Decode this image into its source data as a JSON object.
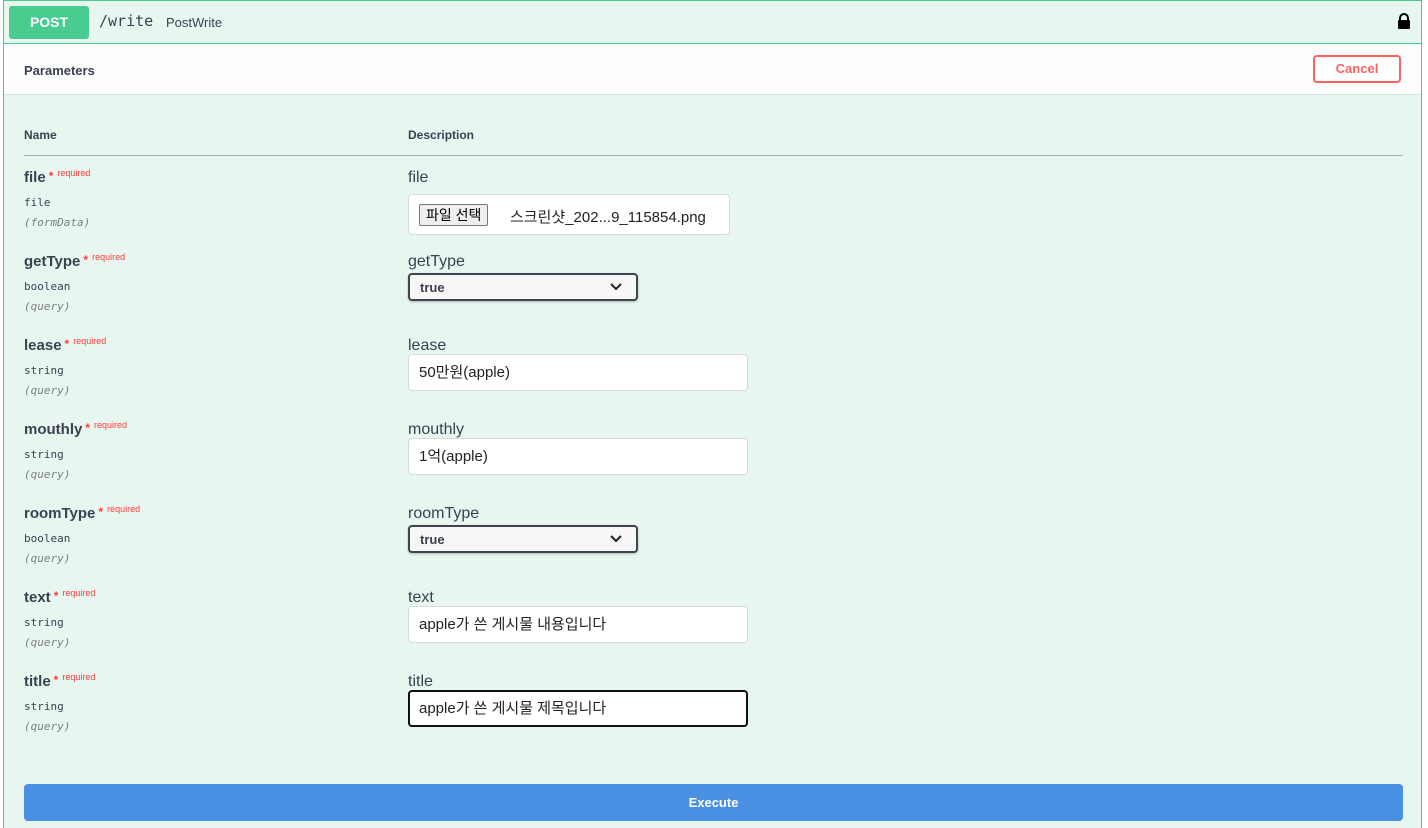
{
  "operation": {
    "method": "POST",
    "path": "/write",
    "summary": "PostWrite"
  },
  "section": {
    "title": "Parameters",
    "cancel_label": "Cancel"
  },
  "columns": {
    "name": "Name",
    "description": "Description"
  },
  "required_label": "required",
  "required_star": "*",
  "params": [
    {
      "name": "file",
      "type": "file",
      "in": "(formData)",
      "label": "file",
      "control": "file",
      "button_label": "파일 선택",
      "value": "스크린샷_202...9_115854.png"
    },
    {
      "name": "getType",
      "type": "boolean",
      "in": "(query)",
      "label": "getType",
      "control": "select",
      "value": "true"
    },
    {
      "name": "lease",
      "type": "string",
      "in": "(query)",
      "label": "lease",
      "control": "text",
      "value": "50만원(apple)"
    },
    {
      "name": "mouthly",
      "type": "string",
      "in": "(query)",
      "label": "mouthly",
      "control": "text",
      "value": "1억(apple)"
    },
    {
      "name": "roomType",
      "type": "boolean",
      "in": "(query)",
      "label": "roomType",
      "control": "select",
      "value": "true"
    },
    {
      "name": "text",
      "type": "string",
      "in": "(query)",
      "label": "text",
      "control": "text",
      "value": "apple가 쓴 게시물 내용입니다"
    },
    {
      "name": "title",
      "type": "string",
      "in": "(query)",
      "label": "title",
      "control": "text",
      "value": "apple가 쓴 게시물 제목입니다",
      "focused": true
    }
  ],
  "execute_label": "Execute",
  "colors": {
    "post_green": "#49cc90",
    "block_bg": "#e8f6f0",
    "cancel_red": "#ff6060",
    "execute_blue": "#4990e2"
  },
  "icons": {
    "lock": "lock-icon",
    "chevron": "chevron-down-icon"
  }
}
